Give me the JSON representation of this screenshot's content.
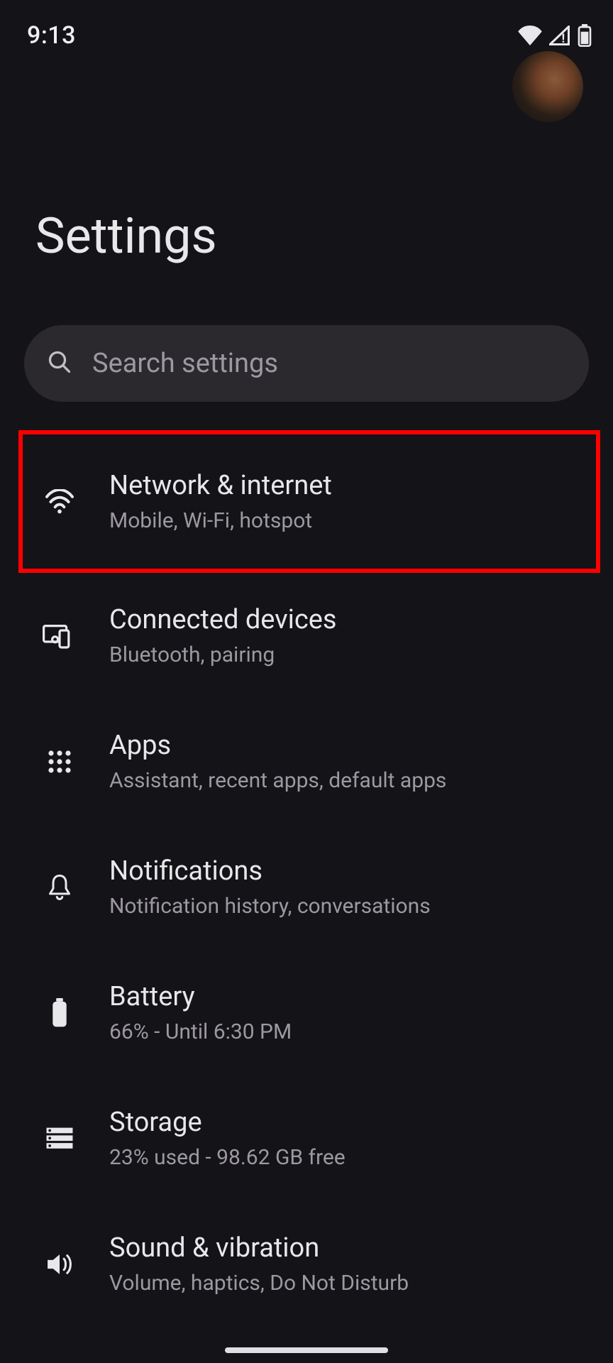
{
  "status": {
    "time": "9:13"
  },
  "header": {
    "title": "Settings"
  },
  "search": {
    "placeholder": "Search settings"
  },
  "items": [
    {
      "title": "Network & internet",
      "sub": "Mobile, Wi-Fi, hotspot",
      "highlight": true
    },
    {
      "title": "Connected devices",
      "sub": "Bluetooth, pairing",
      "highlight": false
    },
    {
      "title": "Apps",
      "sub": "Assistant, recent apps, default apps",
      "highlight": false
    },
    {
      "title": "Notifications",
      "sub": "Notification history, conversations",
      "highlight": false
    },
    {
      "title": "Battery",
      "sub": "66% - Until 6:30 PM",
      "highlight": false
    },
    {
      "title": "Storage",
      "sub": "23% used - 98.62 GB free",
      "highlight": false
    },
    {
      "title": "Sound & vibration",
      "sub": "Volume, haptics, Do Not Disturb",
      "highlight": false
    }
  ]
}
